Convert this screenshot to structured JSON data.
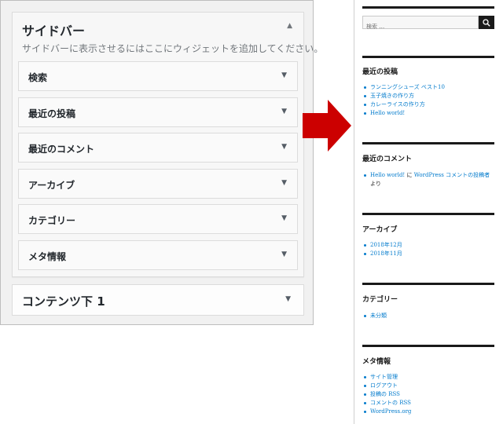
{
  "admin": {
    "sidebar": {
      "title": "サイドバー",
      "toggle_icon": "triangle-up",
      "description": "サイドバーに表示させるにはここにウィジェットを追加してください。",
      "widgets": [
        {
          "label": "検索"
        },
        {
          "label": "最近の投稿"
        },
        {
          "label": "最近のコメント"
        },
        {
          "label": "アーカイブ"
        },
        {
          "label": "カテゴリー"
        },
        {
          "label": "メタ情報"
        }
      ]
    },
    "content_below": {
      "title": "コンテンツ下 1",
      "toggle_icon": "triangle-down"
    }
  },
  "arrow": {
    "color": "#cc0000",
    "icon": "arrow-right"
  },
  "preview": {
    "search": {
      "placeholder": "検索 …",
      "button_icon": "search-icon"
    },
    "recent_posts": {
      "title": "最近の投稿",
      "items": [
        "ランニングシューズ ベスト10",
        "玉子焼きの作り方",
        "カレーライスの作り方",
        "Hello world!"
      ]
    },
    "recent_comments": {
      "title": "最近のコメント",
      "link": "Hello world!",
      "connector": " に ",
      "author": "WordPress コメントの投稿者",
      "suffix": " より"
    },
    "archives": {
      "title": "アーカイブ",
      "items": [
        "2018年12月",
        "2018年11月"
      ]
    },
    "categories": {
      "title": "カテゴリー",
      "items": [
        "未分類"
      ]
    },
    "meta": {
      "title": "メタ情報",
      "items": [
        "サイト管理",
        "ログアウト",
        "投稿の RSS",
        "コメントの RSS",
        "WordPress.org"
      ]
    },
    "accent_color": "#007acc"
  }
}
